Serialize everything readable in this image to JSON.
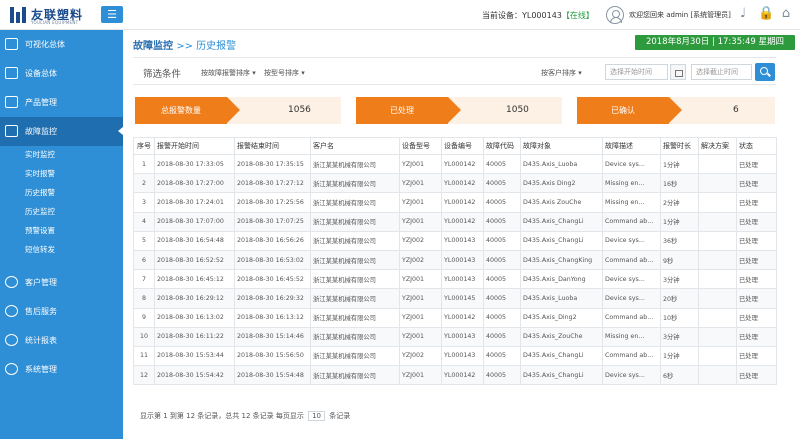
{
  "brand": {
    "name": "友联塑料",
    "tagline": "YOULIAN EQUIPMENT"
  },
  "header": {
    "current_device_label": "当前设备：",
    "current_device_id": "YL000143",
    "current_device_status": "【在线】",
    "welcome": "欢迎您回来 admin [系统管理员]"
  },
  "sidebar": {
    "items": [
      {
        "label": "可视化总体"
      },
      {
        "label": "设备总体"
      },
      {
        "label": "产品管理"
      },
      {
        "label": "故障监控"
      },
      {
        "label": "客户管理"
      },
      {
        "label": "售后服务"
      },
      {
        "label": "统计报表"
      },
      {
        "label": "系统管理"
      }
    ],
    "subitems": [
      {
        "label": "实时监控"
      },
      {
        "label": "实时报警"
      },
      {
        "label": "历史报警"
      },
      {
        "label": "历史监控"
      },
      {
        "label": "预警设置"
      },
      {
        "label": "短信转发"
      }
    ]
  },
  "breadcrumb": {
    "section": "故障监控",
    "separator": ">>",
    "page": "历史报警"
  },
  "clock": "2018年8月30日 | 17:35:49 星期四",
  "filters": {
    "title": "筛选条件",
    "dropdown1": "按故障报警排序",
    "dropdown2": "按型号排序",
    "dropdown3": "按客户排序",
    "start_placeholder": "选择开始时间",
    "end_placeholder": "选择截止时间"
  },
  "stats": [
    {
      "label": "总报警数量",
      "value": "1056"
    },
    {
      "label": "已处理",
      "value": "1050"
    },
    {
      "label": "已确认",
      "value": "6"
    }
  ],
  "table": {
    "headers": [
      "序号",
      "报警开始时间",
      "报警结束时间",
      "客户名",
      "设备型号",
      "设备编号",
      "故障代码",
      "故障对象",
      "故障描述",
      "报警时长",
      "解决方案",
      "状态"
    ],
    "rows": [
      [
        "1",
        "2018-08-30 17:33:05",
        "2018-08-30 17:35:15",
        "浙江某某机械有限公司",
        "YZJ001",
        "YL000142",
        "40005",
        "D435.Axis_Luoba",
        "Device sys...",
        "1分钟",
        "",
        "已处理"
      ],
      [
        "2",
        "2018-08-30 17:27:00",
        "2018-08-30 17:27:12",
        "浙江某某机械有限公司",
        "YZJ001",
        "YL000142",
        "40005",
        "D435.Axis Ding2",
        "Missing en...",
        "16秒",
        "",
        "已处理"
      ],
      [
        "3",
        "2018-08-30 17:24:01",
        "2018-08-30 17:25:56",
        "浙江某某机械有限公司",
        "YZJ001",
        "YL000142",
        "40005",
        "D435.Axis ZouChe",
        "Missing en...",
        "2分钟",
        "",
        "已处理"
      ],
      [
        "4",
        "2018-08-30 17:07:00",
        "2018-08-30 17:07:25",
        "浙江某某机械有限公司",
        "YZJ001",
        "YL000142",
        "40005",
        "D435.Axis_ChangLi",
        "Command ab...",
        "1分钟",
        "",
        "已处理"
      ],
      [
        "5",
        "2018-08-30 16:54:48",
        "2018-08-30 16:56:26",
        "浙江某某机械有限公司",
        "YZJ002",
        "YL000143",
        "40005",
        "D435.Axis_ChangLi",
        "Device sys...",
        "36秒",
        "",
        "已处理"
      ],
      [
        "6",
        "2018-08-30 16:52:52",
        "2018-08-30 16:53:02",
        "浙江某某机械有限公司",
        "YZJ002",
        "YL000143",
        "40005",
        "D435.Axis_ChangKing",
        "Command ab...",
        "9秒",
        "",
        "已处理"
      ],
      [
        "7",
        "2018-08-30 16:45:12",
        "2018-08-30 16:45:52",
        "浙江某某机械有限公司",
        "YZJ001",
        "YL000143",
        "40005",
        "D435.Axis_DanYong",
        "Device sys...",
        "3分钟",
        "",
        "已处理"
      ],
      [
        "8",
        "2018-08-30 16:29:12",
        "2018-08-30 16:29:32",
        "浙江某某机械有限公司",
        "YZJ001",
        "YL000145",
        "40005",
        "D435.Axis_Luoba",
        "Device sys...",
        "20秒",
        "",
        "已处理"
      ],
      [
        "9",
        "2018-08-30 16:13:02",
        "2018-08-30 16:13:12",
        "浙江某某机械有限公司",
        "YZJ001",
        "YL000142",
        "40005",
        "D435.Axis_Ding2",
        "Command ab...",
        "10秒",
        "",
        "已处理"
      ],
      [
        "10",
        "2018-08-30 16:11:22",
        "2018-08-30 15:14:46",
        "浙江某某机械有限公司",
        "YZJ001",
        "YL000143",
        "40005",
        "D435.Axis_ZouChe",
        "Missing en...",
        "3分钟",
        "",
        "已处理"
      ],
      [
        "11",
        "2018-08-30 15:53:44",
        "2018-08-30 15:56:50",
        "浙江某某机械有限公司",
        "YZJ002",
        "YL000143",
        "40005",
        "D435.Axis_ChangLi",
        "Command ab...",
        "1分钟",
        "",
        "已处理"
      ],
      [
        "12",
        "2018-08-30 15:54:42",
        "2018-08-30 15:54:48",
        "浙江某某机械有限公司",
        "YZJ001",
        "YL000142",
        "40005",
        "D435.Axis_ChangLi",
        "Device sys...",
        "6秒",
        "",
        "已处理"
      ]
    ]
  },
  "footer": {
    "summary": "显示第 1 到第 12 条记录，总共 12 条记录 每页显示",
    "page_size": "10",
    "suffix": "条记录"
  },
  "colors": {
    "primary": "#2e8fd6",
    "accent": "#ef7d1a",
    "success": "#2e9a3e"
  }
}
